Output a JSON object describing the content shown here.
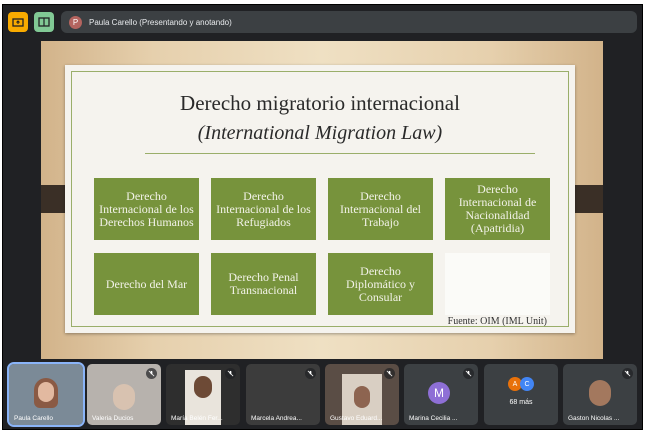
{
  "presenter": {
    "avatar_letter": "P",
    "label": "Paula Carello (Presentando y anotando)"
  },
  "slide": {
    "title": "Derecho migratorio internacional",
    "subtitle": "(International Migration Law)",
    "boxes": [
      "Derecho Internacional de los Derechos Humanos",
      "Derecho Internacional de los Refugiados",
      "Derecho Internacional del Trabajo",
      "Derecho Internacional de Nacionalidad (Apatridia)",
      "Derecho del Mar",
      "Derecho Penal Transnacional",
      "Derecho Diplomático y Consular"
    ],
    "source": "Fuente: OIM (IML Unit)"
  },
  "participants": [
    {
      "name": "Paula Carello"
    },
    {
      "name": "Valeria Ducios"
    },
    {
      "name": "María Belén Fer..."
    },
    {
      "name": "Marcela Andrea..."
    },
    {
      "name": "Gustavo Eduard..."
    },
    {
      "name": "Marina Cecilia ...",
      "avatar_letter": "M"
    },
    {
      "more_label": "68 más",
      "avatar_a": "A",
      "avatar_c": "C"
    },
    {
      "name": "Gaston Nicolas ..."
    }
  ],
  "colors": {
    "accent_yellow": "#f9ab00",
    "accent_green": "#81c995",
    "slide_box_green": "#77933c"
  }
}
